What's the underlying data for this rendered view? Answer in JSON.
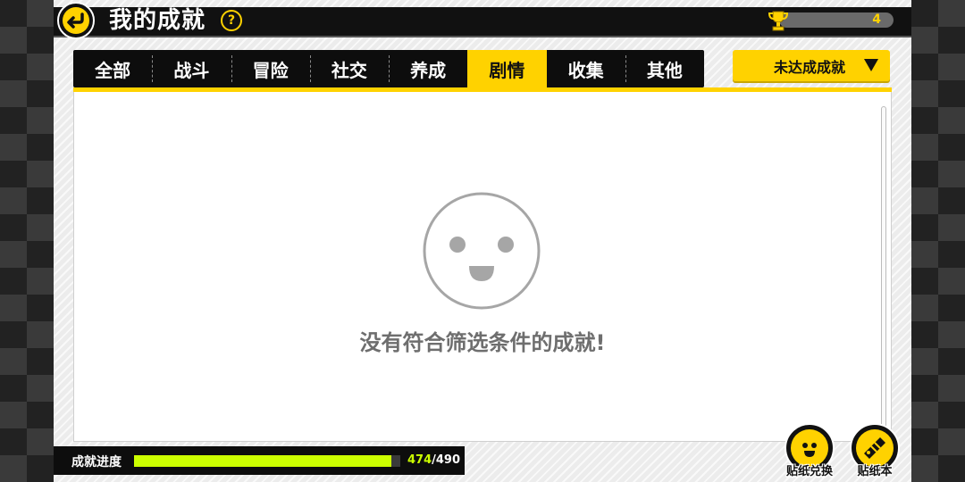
{
  "header": {
    "title": "我的成就",
    "help_label": "?",
    "trophy_count": "4"
  },
  "tabs": [
    {
      "label": "全部"
    },
    {
      "label": "战斗"
    },
    {
      "label": "冒险"
    },
    {
      "label": "社交"
    },
    {
      "label": "养成"
    },
    {
      "label": "剧情"
    },
    {
      "label": "收集"
    },
    {
      "label": "其他"
    }
  ],
  "active_tab": "剧情",
  "filter": {
    "selected": "未达成成就"
  },
  "content": {
    "empty_message": "没有符合筛选条件的成就!"
  },
  "progress": {
    "label": "成就进度",
    "current": "474",
    "separator": "/",
    "total": "490",
    "fraction": 0.967
  },
  "buttons": {
    "sticker_exchange": "贴纸兑换",
    "sticker_book": "贴纸本"
  },
  "colors": {
    "accent": "#ffd200",
    "progress_fill": "#ccff00",
    "empty_text": "#6e6e6e"
  },
  "icons": [
    "back-arrow-icon",
    "help-icon",
    "trophy-icon",
    "smiley-face-icon",
    "dropdown-arrow-icon",
    "sticker-face-icon",
    "sticker-book-icon"
  ]
}
